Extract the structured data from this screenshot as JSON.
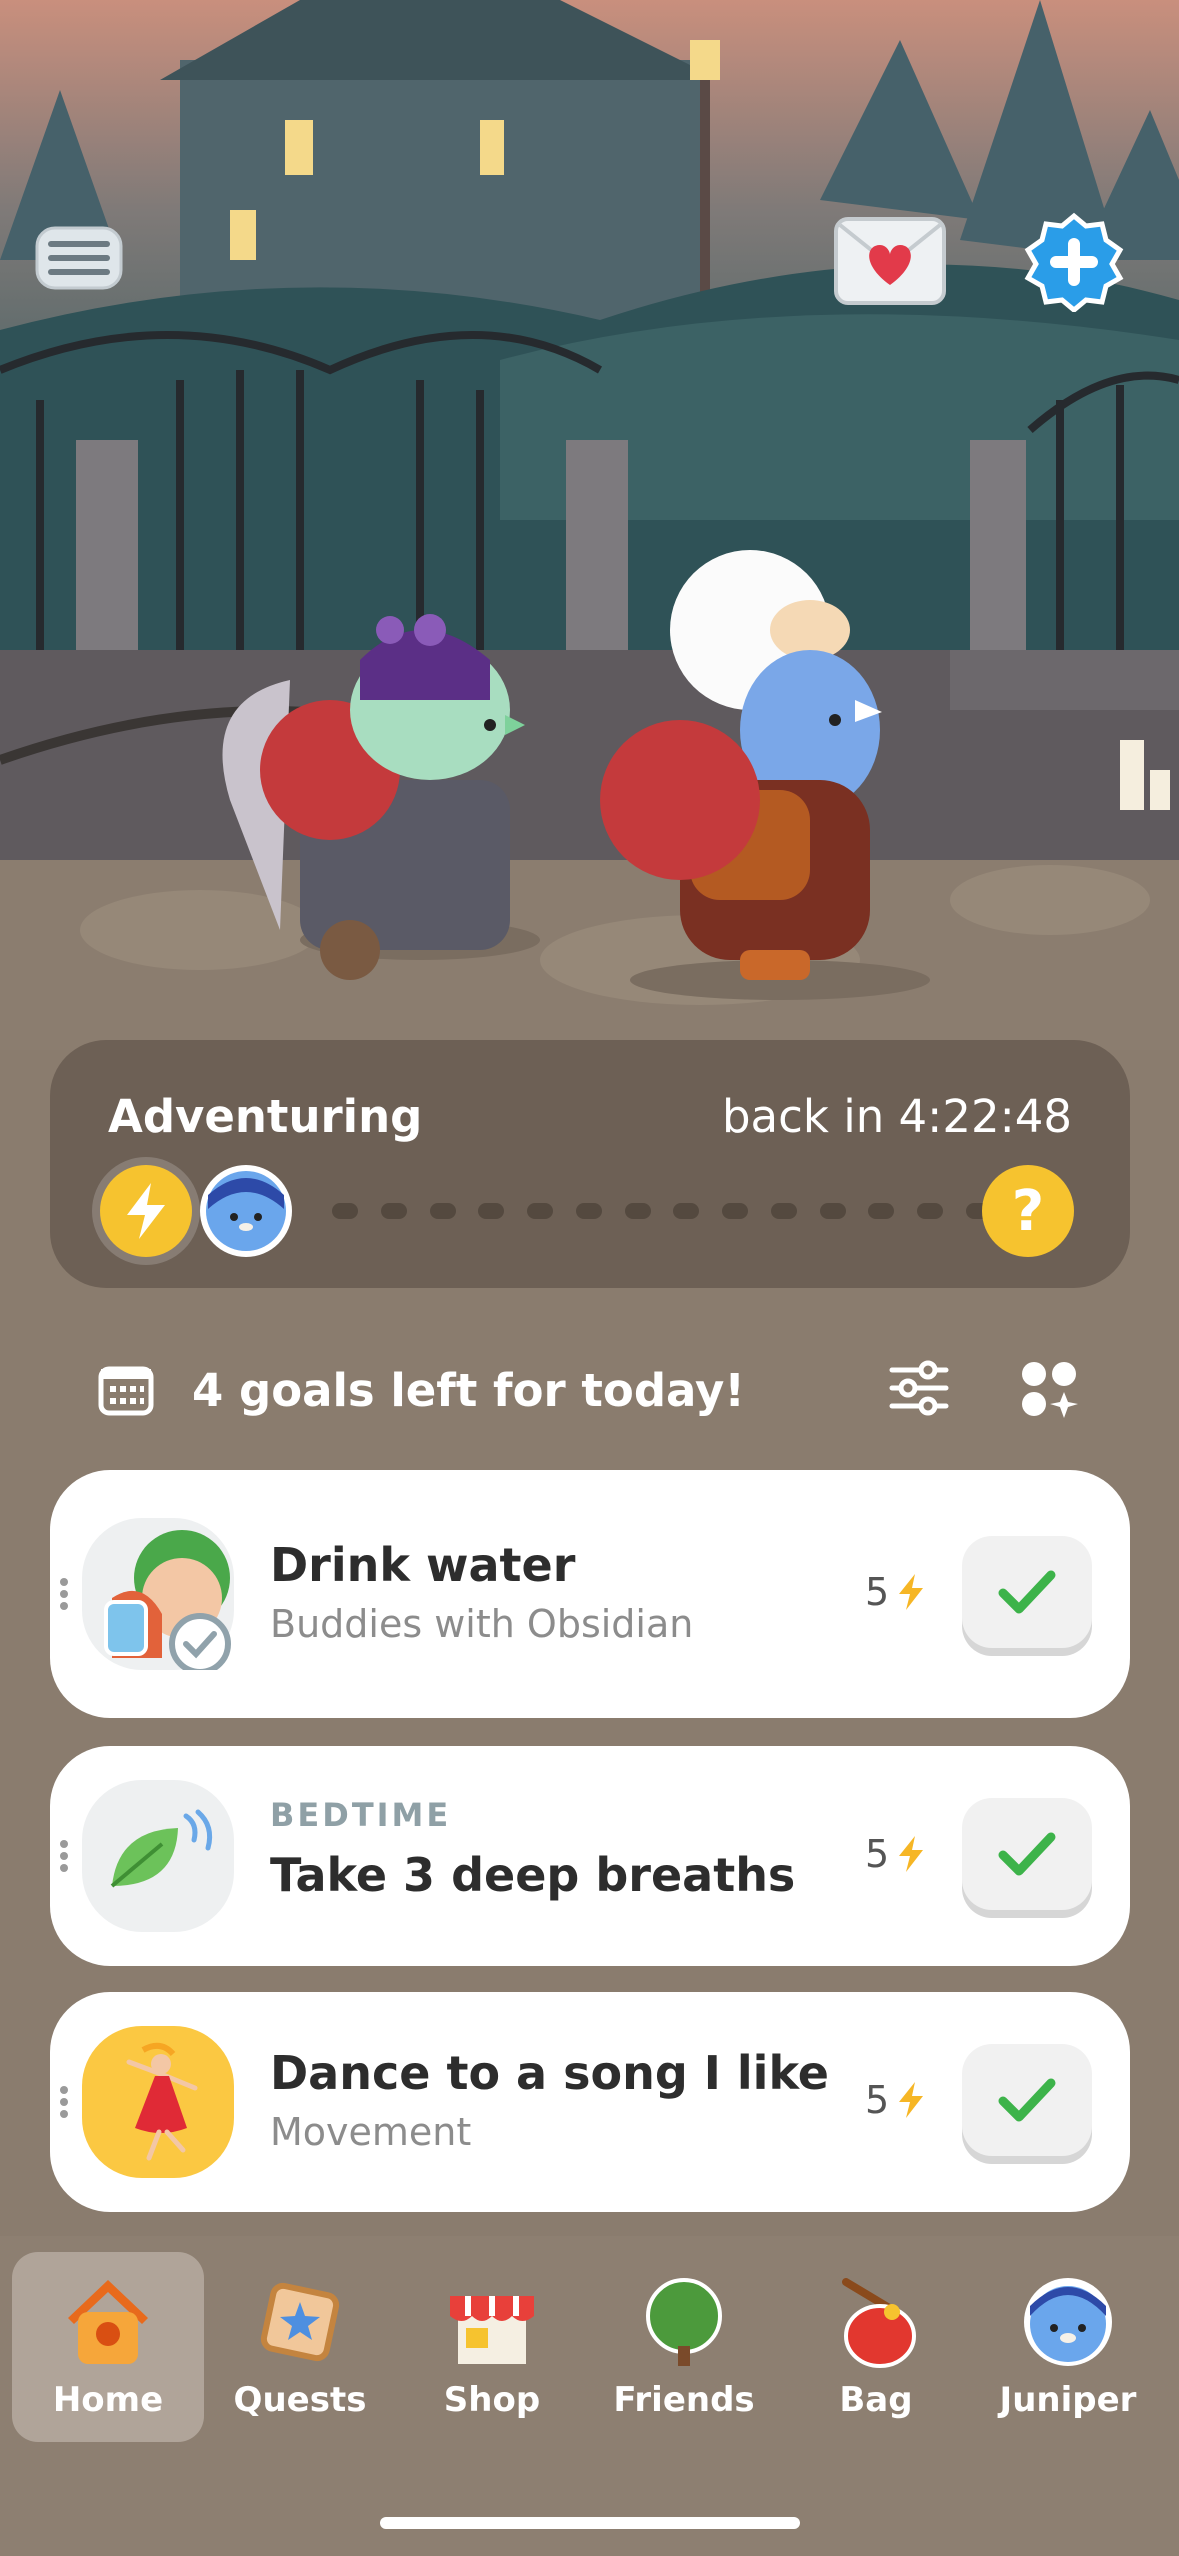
{
  "header": {
    "menu_icon": "hamburger-icon",
    "mail_icon": "heart-envelope-icon",
    "add_friend_icon": "plus-badge-icon"
  },
  "adventure": {
    "title": "Adventuring",
    "timer": "back in 4:22:48",
    "energy_icon": "lightning-icon",
    "companion_avatar": "juniper-avatar",
    "unknown_icon": "question-icon",
    "unknown_glyph": "?"
  },
  "goals": {
    "summary": "4 goals left for today!",
    "calendar_icon": "calendar-icon",
    "filter_icon": "sliders-icon",
    "grid_icon": "add-widget-icon"
  },
  "tasks": [
    {
      "title": "Drink water",
      "subtitle": "Buddies with Obsidian",
      "category": "",
      "points": "5",
      "icon": "water-glass-buddy-icon"
    },
    {
      "title": "Take 3 deep breaths",
      "subtitle": "",
      "category": "BEDTIME",
      "points": "5",
      "icon": "leaf-breeze-icon"
    },
    {
      "title": "Dance to a song I like",
      "subtitle": "Movement",
      "category": "",
      "points": "5",
      "icon": "dancer-icon"
    }
  ],
  "tabs": [
    {
      "label": "Home",
      "icon": "birdhouse-icon",
      "active": true
    },
    {
      "label": "Quests",
      "icon": "quest-scroll-icon",
      "active": false
    },
    {
      "label": "Shop",
      "icon": "shop-stall-icon",
      "active": false
    },
    {
      "label": "Friends",
      "icon": "tree-icon",
      "active": false
    },
    {
      "label": "Bag",
      "icon": "bag-icon",
      "active": false
    },
    {
      "label": "Juniper",
      "icon": "juniper-avatar-icon",
      "active": false
    }
  ],
  "colors": {
    "accent_yellow": "#f6c32f",
    "check_green": "#3db34a",
    "background": "#8a7c6e"
  }
}
